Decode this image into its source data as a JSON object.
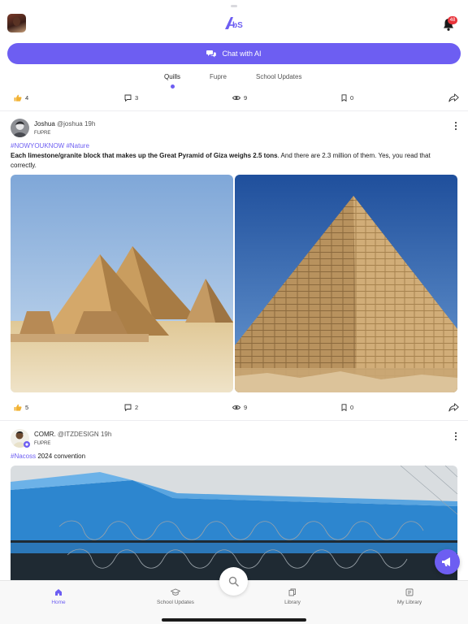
{
  "header": {
    "logo_text": "AbS",
    "notification_count": "48"
  },
  "chat_button": {
    "label": "Chat with AI"
  },
  "tabs": [
    {
      "label": "Quills",
      "active": true
    },
    {
      "label": "Fupre",
      "active": false
    },
    {
      "label": "School Updates",
      "active": false
    }
  ],
  "posts": [
    {
      "likes": "4",
      "comments": "3",
      "views": "9",
      "bookmarks": "0"
    },
    {
      "name": "Joshua",
      "handle": "@joshua",
      "time": "19h",
      "school": "FUPRE",
      "hashtags": "#NOWYOUKNOW #Nature",
      "text_bold": "Each limestone/granite block that makes up the Great Pyramid of Giza weighs 2.5 tons",
      "text_rest": ". And there are 2.3 million of them. Yes, you read that correctly.",
      "likes": "5",
      "comments": "2",
      "views": "9",
      "bookmarks": "0"
    },
    {
      "name": "COMR.",
      "handle": "@ITZDESIGN",
      "time": "19h",
      "school": "FUPRE",
      "hashtag": "#Nacoss",
      "text": " 2024 convention"
    }
  ],
  "bottom_nav": [
    {
      "label": "Home",
      "icon": "home-icon",
      "active": true
    },
    {
      "label": "School Updates",
      "icon": "graduation-cap-icon",
      "active": false
    },
    {
      "label": "Library",
      "icon": "library-icon",
      "active": false
    },
    {
      "label": "My Library",
      "icon": "my-library-icon",
      "active": false
    }
  ],
  "colors": {
    "accent": "#6d5ef2",
    "badge": "#e8333a"
  }
}
